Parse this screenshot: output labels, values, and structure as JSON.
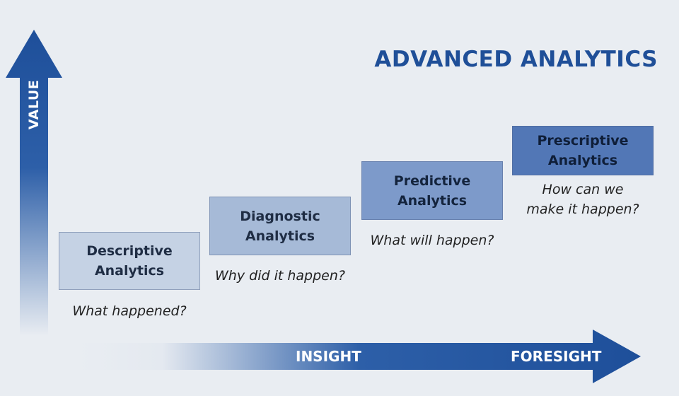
{
  "title": "ADVANCED ANALYTICS",
  "axes": {
    "vertical_label": "VALUE",
    "horizontal_labels": [
      "INSIGHT",
      "FORESIGHT"
    ]
  },
  "colors": {
    "accent": "#1f4f98",
    "arrow": "#1e4f9a",
    "background": "#e9edf2"
  },
  "stages": [
    {
      "label_lines": [
        "Descriptive",
        "Analytics"
      ],
      "question_lines": [
        "What happened?"
      ],
      "fill": "#c5d2e4",
      "text_color": "#1f2d44"
    },
    {
      "label_lines": [
        "Diagnostic",
        "Analytics"
      ],
      "question_lines": [
        "Why did it happen?"
      ],
      "fill": "#a6bad7",
      "text_color": "#1f2d44"
    },
    {
      "label_lines": [
        "Predictive",
        "Analytics"
      ],
      "question_lines": [
        "What will happen?"
      ],
      "fill": "#7d9aca",
      "text_color": "#14243d"
    },
    {
      "label_lines": [
        "Prescriptive",
        "Analytics"
      ],
      "question_lines": [
        "How can we",
        "make it happen?"
      ],
      "fill": "#5277b6",
      "text_color": "#0f1e38"
    }
  ]
}
